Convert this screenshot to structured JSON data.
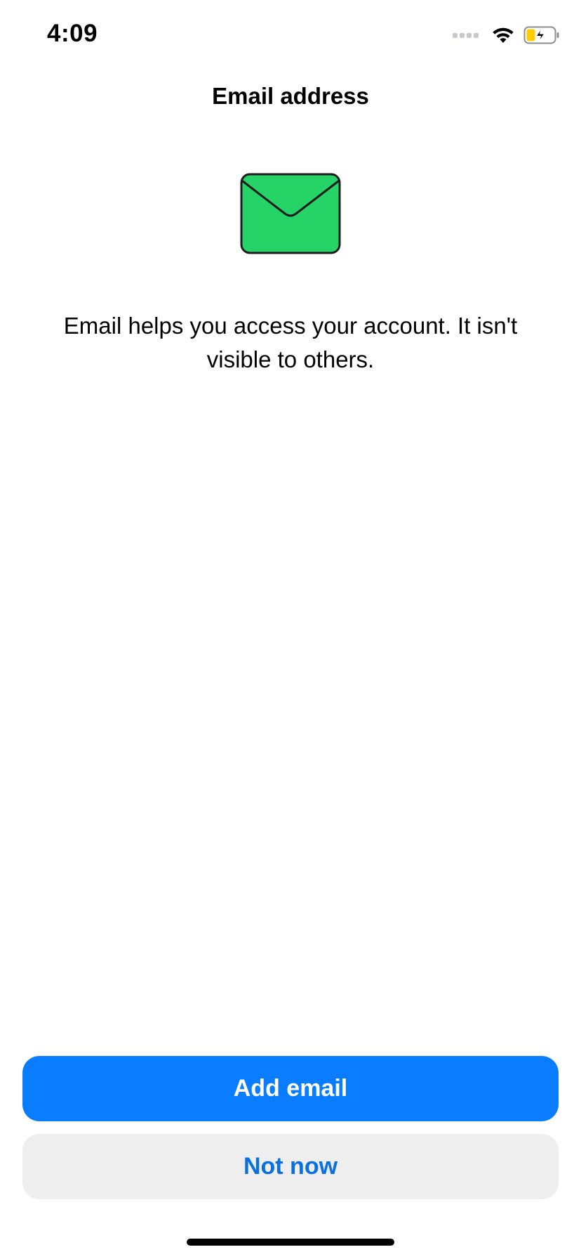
{
  "status_bar": {
    "time": "4:09",
    "signal_icon": "cellular-signal-icon",
    "wifi_icon": "wifi-icon",
    "battery_icon": "battery-charging-icon",
    "battery_color": "#ffcc00"
  },
  "header": {
    "title": "Email address"
  },
  "hero": {
    "icon": "envelope-icon",
    "icon_color": "#26d366"
  },
  "body": {
    "description": "Email helps you access your account. It isn't visible to others."
  },
  "actions": {
    "primary_label": "Add email",
    "secondary_label": "Not now",
    "primary_color": "#0a7cff"
  }
}
